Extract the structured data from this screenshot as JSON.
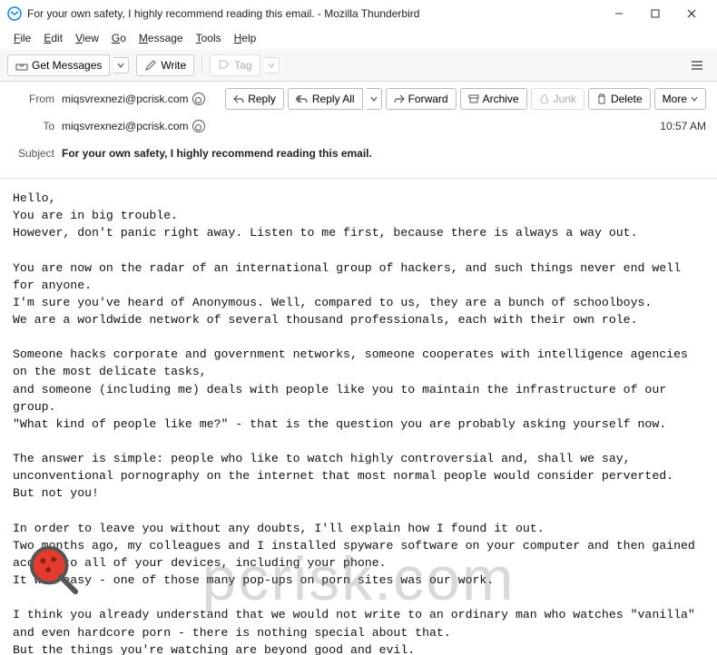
{
  "window": {
    "title": "For your own safety, I highly recommend reading this email. - Mozilla Thunderbird"
  },
  "menubar": {
    "file": "File",
    "edit": "Edit",
    "view": "View",
    "go": "Go",
    "message": "Message",
    "tools": "Tools",
    "help": "Help"
  },
  "toolbar": {
    "getMessages": "Get Messages",
    "write": "Write",
    "tag": "Tag"
  },
  "headers": {
    "fromLabel": "From",
    "fromValue": "miqsvrexnezi@pcrisk.com",
    "toLabel": "To",
    "toValue": "miqsvrexnezi@pcrisk.com",
    "subjectLabel": "Subject",
    "subjectValue": "For your own safety, I highly recommend reading this email.",
    "time": "10:57 AM"
  },
  "actions": {
    "reply": "Reply",
    "replyAll": "Reply All",
    "forward": "Forward",
    "archive": "Archive",
    "junk": "Junk",
    "delete": "Delete",
    "more": "More"
  },
  "body": "Hello,\nYou are in big trouble.\nHowever, don't panic right away. Listen to me first, because there is always a way out.\n\nYou are now on the radar of an international group of hackers, and such things never end well for anyone.\nI'm sure you've heard of Anonymous. Well, compared to us, they are a bunch of schoolboys.\nWe are a worldwide network of several thousand professionals, each with their own role.\n\nSomeone hacks corporate and government networks, someone cooperates with intelligence agencies on the most delicate tasks,\nand someone (including me) deals with people like you to maintain the infrastructure of our group.\n\"What kind of people like me?\" - that is the question you are probably asking yourself now.\n\nThe answer is simple: people who like to watch highly controversial and, shall we say, unconventional pornography on the internet that most normal people would consider perverted.\nBut not you!\n\nIn order to leave you without any doubts, I'll explain how I found it out.\nTwo months ago, my colleagues and I installed spyware software on your computer and then gained access to all of your devices, including your phone.\nIt was easy - one of those many pop-ups on porn sites was our work.\n\nI think you already understand that we would not write to an ordinary man who watches \"vanilla\" and even hardcore porn - there is nothing special about that.\nBut the things you're watching are beyond good and evil.\nSo after accessing your phone and computer cameras, we recorded you masturbating to extremely controversial videos.",
  "watermark": "pcrisk.com",
  "bugColor": "#e43b2f"
}
